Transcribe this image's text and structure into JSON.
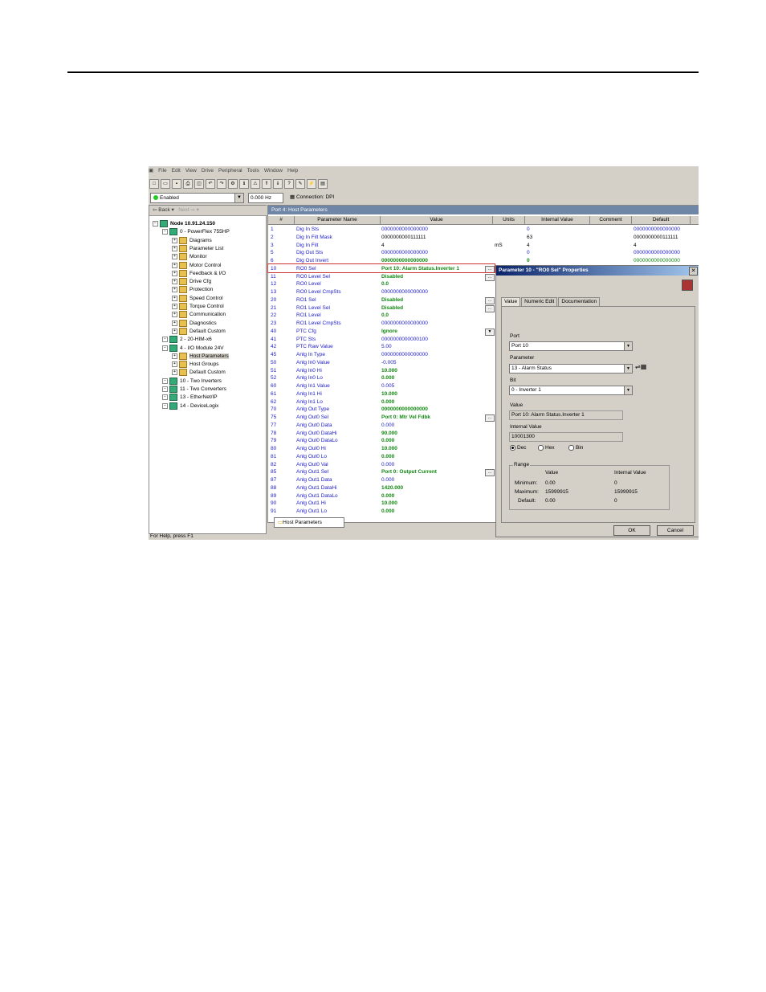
{
  "menu": [
    "File",
    "Edit",
    "View",
    "Drive",
    "Peripheral",
    "Tools",
    "Window",
    "Help"
  ],
  "status": {
    "state": "Enabled",
    "frequency": "0.000 Hz",
    "connection": "Connection: DPI"
  },
  "nav": {
    "back": "Back",
    "next": "Next"
  },
  "tree": [
    {
      "label": "Node 10.91.24.150",
      "indent": 0,
      "bold": true
    },
    {
      "label": "0 - PowerFlex 755HP",
      "indent": 1
    },
    {
      "label": "Diagrams",
      "indent": 2
    },
    {
      "label": "Parameter List",
      "indent": 2
    },
    {
      "label": "Monitor",
      "indent": 2
    },
    {
      "label": "Motor Control",
      "indent": 2
    },
    {
      "label": "Feedback & I/O",
      "indent": 2
    },
    {
      "label": "Drive Cfg",
      "indent": 2
    },
    {
      "label": "Protection",
      "indent": 2
    },
    {
      "label": "Speed Control",
      "indent": 2
    },
    {
      "label": "Torque Control",
      "indent": 2
    },
    {
      "label": "Communication",
      "indent": 2
    },
    {
      "label": "Diagnostics",
      "indent": 2
    },
    {
      "label": "Default Custom",
      "indent": 2
    },
    {
      "label": "2 - 20-HIM-x6",
      "indent": 1
    },
    {
      "label": "4 - I/O Module 24V",
      "indent": 1
    },
    {
      "label": "Host Parameters",
      "indent": 2,
      "selected": true
    },
    {
      "label": "Host Groups",
      "indent": 2
    },
    {
      "label": "Default Custom",
      "indent": 2
    },
    {
      "label": "10 - Two Inverters",
      "indent": 1
    },
    {
      "label": "11 - Two Converters",
      "indent": 1
    },
    {
      "label": "13 - EtherNet/IP",
      "indent": 1
    },
    {
      "label": "14 - DeviceLogix",
      "indent": 1
    }
  ],
  "grid": {
    "title": "Port 4: Host Parameters",
    "headers": {
      "num": "#",
      "name": "Parameter Name",
      "value": "Value",
      "units": "Units",
      "internal": "Internal Value",
      "comment": "Comment",
      "default": "Default"
    },
    "rows": [
      {
        "n": "1",
        "name": "Dig In Sts",
        "value": "0000000000000000",
        "vc": "blue",
        "internal": "0",
        "ic": "blue",
        "def": "0000000000000000"
      },
      {
        "n": "2",
        "name": "Dig In Filt Mask",
        "value": "0000000000111111",
        "vc": "black",
        "internal": "63",
        "ic": "black",
        "def": "0000000000111111"
      },
      {
        "n": "3",
        "name": "Dig In Filt",
        "value": "4",
        "vc": "black",
        "units": "mS",
        "internal": "4",
        "ic": "black",
        "def": "4"
      },
      {
        "n": "5",
        "name": "Dig Out Sts",
        "value": "0000000000000000",
        "vc": "blue",
        "internal": "0",
        "ic": "blue",
        "def": "0000000000000000"
      },
      {
        "n": "6",
        "name": "Dig Out Invert",
        "value": "0000000000000000",
        "vc": "green",
        "internal": "0",
        "ic": "green",
        "def": "0000000000000000"
      },
      {
        "n": "10",
        "name": "RO0 Sel",
        "value": "Port 10: Alarm Status.Inverter 1",
        "vc": "green",
        "dots": true
      },
      {
        "n": "11",
        "name": "RO0 Level Sel",
        "value": "Disabled",
        "vc": "green",
        "dots": true
      },
      {
        "n": "12",
        "name": "RO0 Level",
        "value": "0.0",
        "vc": "green"
      },
      {
        "n": "13",
        "name": "RO0 Level CmpSts",
        "value": "0000000000000000",
        "vc": "blue"
      },
      {
        "n": "20",
        "name": "RO1 Sel",
        "value": "Disabled",
        "vc": "green",
        "dots": true
      },
      {
        "n": "21",
        "name": "RO1 Level Sel",
        "value": "Disabled",
        "vc": "green",
        "dots": true
      },
      {
        "n": "22",
        "name": "RO1 Level",
        "value": "0.0",
        "vc": "green"
      },
      {
        "n": "23",
        "name": "RO1 Level CmpSts",
        "value": "0000000000000000",
        "vc": "blue"
      },
      {
        "n": "40",
        "name": "PTC Cfg",
        "value": "Ignore",
        "vc": "green",
        "drop": true
      },
      {
        "n": "41",
        "name": "PTC Sts",
        "value": "0000000000000100",
        "vc": "blue"
      },
      {
        "n": "42",
        "name": "PTC Raw Value",
        "value": "5.00",
        "vc": "blue"
      },
      {
        "n": "45",
        "name": "Anlg In Type",
        "value": "0000000000000000",
        "vc": "blue"
      },
      {
        "n": "50",
        "name": "Anlg In0 Value",
        "value": "-0.005",
        "vc": "blue"
      },
      {
        "n": "51",
        "name": "Anlg In0 Hi",
        "value": "10.000",
        "vc": "green"
      },
      {
        "n": "52",
        "name": "Anlg In0 Lo",
        "value": "0.000",
        "vc": "green"
      },
      {
        "n": "60",
        "name": "Anlg In1 Value",
        "value": "0.005",
        "vc": "blue"
      },
      {
        "n": "61",
        "name": "Anlg In1 Hi",
        "value": "10.000",
        "vc": "green"
      },
      {
        "n": "62",
        "name": "Anlg In1 Lo",
        "value": "0.000",
        "vc": "green"
      },
      {
        "n": "70",
        "name": "Anlg Out Type",
        "value": "0000000000000000",
        "vc": "green"
      },
      {
        "n": "75",
        "name": "Anlg Out0 Sel",
        "value": "Port 0: Mtr Vel Fdbk",
        "vc": "green",
        "dots": true
      },
      {
        "n": "77",
        "name": "Anlg Out0 Data",
        "value": "0.000",
        "vc": "blue"
      },
      {
        "n": "78",
        "name": "Anlg Out0 DataHi",
        "value": "90.000",
        "vc": "green"
      },
      {
        "n": "79",
        "name": "Anlg Out0 DataLo",
        "value": "0.000",
        "vc": "green"
      },
      {
        "n": "80",
        "name": "Anlg Out0 Hi",
        "value": "10.000",
        "vc": "green"
      },
      {
        "n": "81",
        "name": "Anlg Out0 Lo",
        "value": "0.000",
        "vc": "green"
      },
      {
        "n": "82",
        "name": "Anlg Out0 Val",
        "value": "0.000",
        "vc": "blue"
      },
      {
        "n": "85",
        "name": "Anlg Out1 Sel",
        "value": "Port 0: Output Current",
        "vc": "green",
        "dots": true
      },
      {
        "n": "87",
        "name": "Anlg Out1 Data",
        "value": "0.000",
        "vc": "blue"
      },
      {
        "n": "88",
        "name": "Anlg Out1 DataHi",
        "value": "1420.000",
        "vc": "green"
      },
      {
        "n": "89",
        "name": "Anlg Out1 DataLo",
        "value": "0.000",
        "vc": "green"
      },
      {
        "n": "90",
        "name": "Anlg Out1 Hi",
        "value": "10.000",
        "vc": "green"
      },
      {
        "n": "91",
        "name": "Anlg Out1 Lo",
        "value": "0.000",
        "vc": "green"
      }
    ]
  },
  "bottom_tab": "Host Parameters",
  "help": "For Help, press F1",
  "dialog": {
    "title": "Parameter 10 - \"RO0 Sel\" Properties",
    "tabs": [
      "Value",
      "Numeric Edit",
      "Documentation"
    ],
    "port_label": "Port",
    "port_value": "Port 10",
    "param_label": "Parameter",
    "param_value": "13 - Alarm Status",
    "bit_label": "Bit",
    "bit_value": "0 - Inverter 1",
    "value_label": "Value",
    "value": "Port 10: Alarm Status.Inverter 1",
    "internal_label": "Internal Value",
    "internal": "10001300",
    "radix": [
      "Dec",
      "Hex",
      "Bin"
    ],
    "range_label": "Range",
    "range_value_hdr": "Value",
    "range_internal_hdr": "Internal Value",
    "min_label": "Minimum:",
    "min_value": "0.00",
    "min_internal": "0",
    "max_label": "Maximum:",
    "max_value": "15999915",
    "max_internal": "15999915",
    "def_label": "Default:",
    "def_value": "0.00",
    "def_internal": "0",
    "ok": "OK",
    "cancel": "Cancel"
  }
}
